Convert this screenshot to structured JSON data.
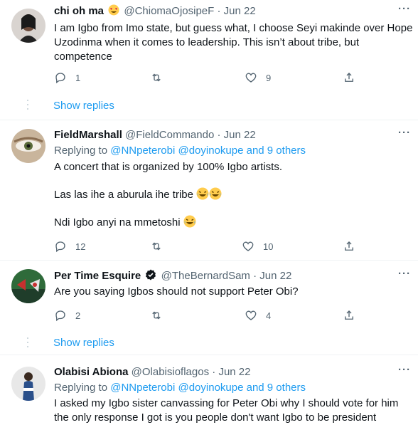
{
  "tweets": [
    {
      "name": "chi oh ma",
      "handle": "@ChiomaOjosipeF",
      "dot": "·",
      "date": "Jun 22",
      "text": "I am Igbo from Imo state, but guess what, I choose Seyi makinde over Hope Uzodinma  when it comes to leadership. This isn’t about tribe, but competence",
      "replies": "1",
      "retweets": "",
      "likes": "9",
      "show_replies": "Show replies"
    },
    {
      "name": "FieldMarshall",
      "handle": "@FieldCommando",
      "dot": "·",
      "date": "Jun 22",
      "replying_prefix": "Replying to ",
      "replying_users": "@NNpeterobi @doyinokupe and 9 others",
      "line1": "A concert that is organized by 100% Igbo artists.",
      "line2": "Las las ihe a aburula ihe tribe",
      "line3": "Ndi Igbo anyi na mmetoshi",
      "replies": "12",
      "retweets": "",
      "likes": "10"
    },
    {
      "name": "Per Time Esquire",
      "handle": "@TheBernardSam",
      "dot": "·",
      "date": "Jun 22",
      "text": "Are you saying Igbos should not support Peter Obi?",
      "replies": "2",
      "retweets": "",
      "likes": "4",
      "show_replies": "Show replies"
    },
    {
      "name": "Olabisi Abiona",
      "handle": "@Olabisioflagos",
      "dot": "·",
      "date": "Jun 22",
      "replying_prefix": "Replying to ",
      "replying_users": "@NNpeterobi @doyinokupe and 9 others",
      "text": "I asked my Igbo sister canvassing for Peter Obi why I should vote for him the only response I got is you people don't want Igbo to be president"
    }
  ],
  "more_label": "···",
  "colors": {
    "link": "#1d9bf0",
    "muted": "#536471",
    "text": "#0f1419",
    "divider": "#eff3f4"
  }
}
